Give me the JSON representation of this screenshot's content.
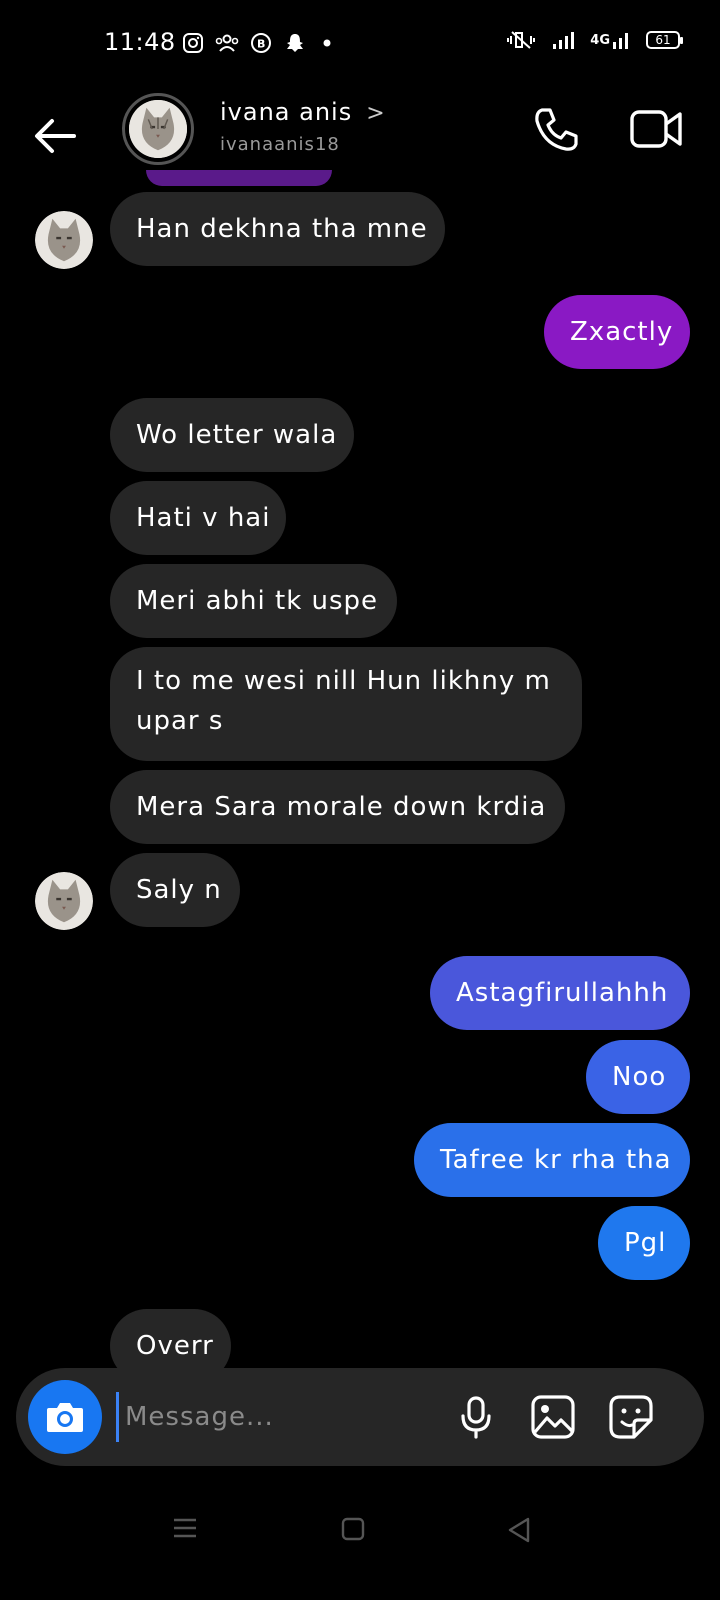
{
  "status_bar": {
    "time": "11:48",
    "battery": "61",
    "network": "4G"
  },
  "header": {
    "name": "ivana anis",
    "chevron": ">",
    "handle": "ivanaanis18"
  },
  "messages": [
    {
      "side": "in",
      "text": "Han dekhna tha mne"
    },
    {
      "side": "out",
      "text": "Zxactly"
    },
    {
      "side": "in",
      "text": "Wo letter wala"
    },
    {
      "side": "in",
      "text": "Hati v hai"
    },
    {
      "side": "in",
      "text": "Meri abhi tk uspe"
    },
    {
      "side": "in",
      "text": "I to me wesi nill Hun likhny m upar s"
    },
    {
      "side": "in",
      "text": "Mera Sara morale down krdia"
    },
    {
      "side": "in",
      "text": "Saly n"
    },
    {
      "side": "out",
      "text": "Astagfirullahhh"
    },
    {
      "side": "out",
      "text": "Noo"
    },
    {
      "side": "out",
      "text": "Tafree kr rha tha"
    },
    {
      "side": "out",
      "text": "Pgl"
    },
    {
      "side": "in",
      "text": "Overr"
    }
  ],
  "composer": {
    "placeholder": "Message..."
  },
  "colors": {
    "incoming": "#262626",
    "outgoing_purple": "#8a19c4",
    "outgoing_blue": "#1f78ee",
    "accent": "#1877f2"
  }
}
